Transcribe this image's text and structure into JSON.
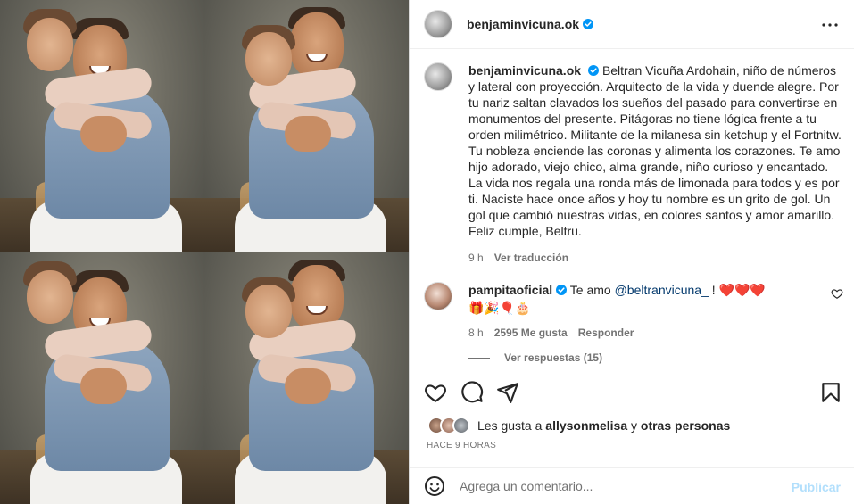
{
  "post": {
    "author": "benjaminvicuna.ok",
    "caption": "Beltran Vicuña Ardohain, niño de números y lateral con proyección. Arquitecto de la vida y duende alegre. Por tu nariz saltan clavados los sueños del pasado para convertirse en monumentos del presente. Pitágoras no tiene lógica frente a tu orden milimétrico. Militante de la milanesa sin ketchup y el Fortnitw. Tu nobleza enciende las coronas y alimenta los corazones. Te amo hijo adorado, viejo chico, alma grande, niño curioso y encantado. La vida nos regala una ronda más de limonada para todos y es por ti. Naciste hace once años y hoy tu nombre es un grito de gol. Un gol que cambió nuestras vidas, en colores santos y amor amarillo. Feliz cumple, Beltru.",
    "caption_time": "9 h",
    "see_translation": "Ver traducción",
    "likes_prefix": "Les gusta a",
    "likes_user": "allysonmelisa",
    "likes_and": "y",
    "likes_others": "otras personas",
    "time_ago": "HACE 9 HORAS"
  },
  "comment": {
    "author": "pampitaoficial",
    "text_prefix": "Te amo",
    "mention": "@beltranvicuna_",
    "text_suffix": "!",
    "hearts": "❤️❤️❤️",
    "emojis": "🎁🎉🎈🎂",
    "time": "8 h",
    "likes": "2595 Me gusta",
    "reply": "Responder",
    "view_replies": "Ver respuestas (15)"
  },
  "composer": {
    "placeholder": "Agrega un comentario...",
    "publish": "Publicar"
  },
  "icons": {
    "verified": "verified-badge-icon",
    "more": "more-options-icon",
    "like": "heart-icon",
    "comment": "comment-icon",
    "share": "share-icon",
    "save": "bookmark-icon",
    "emoji": "emoji-icon"
  },
  "colors": {
    "verified": "#0095f6",
    "link": "#00376b",
    "muted": "#737373",
    "publish_disabled": "#b2dffc",
    "heart": "#ed1c24"
  }
}
